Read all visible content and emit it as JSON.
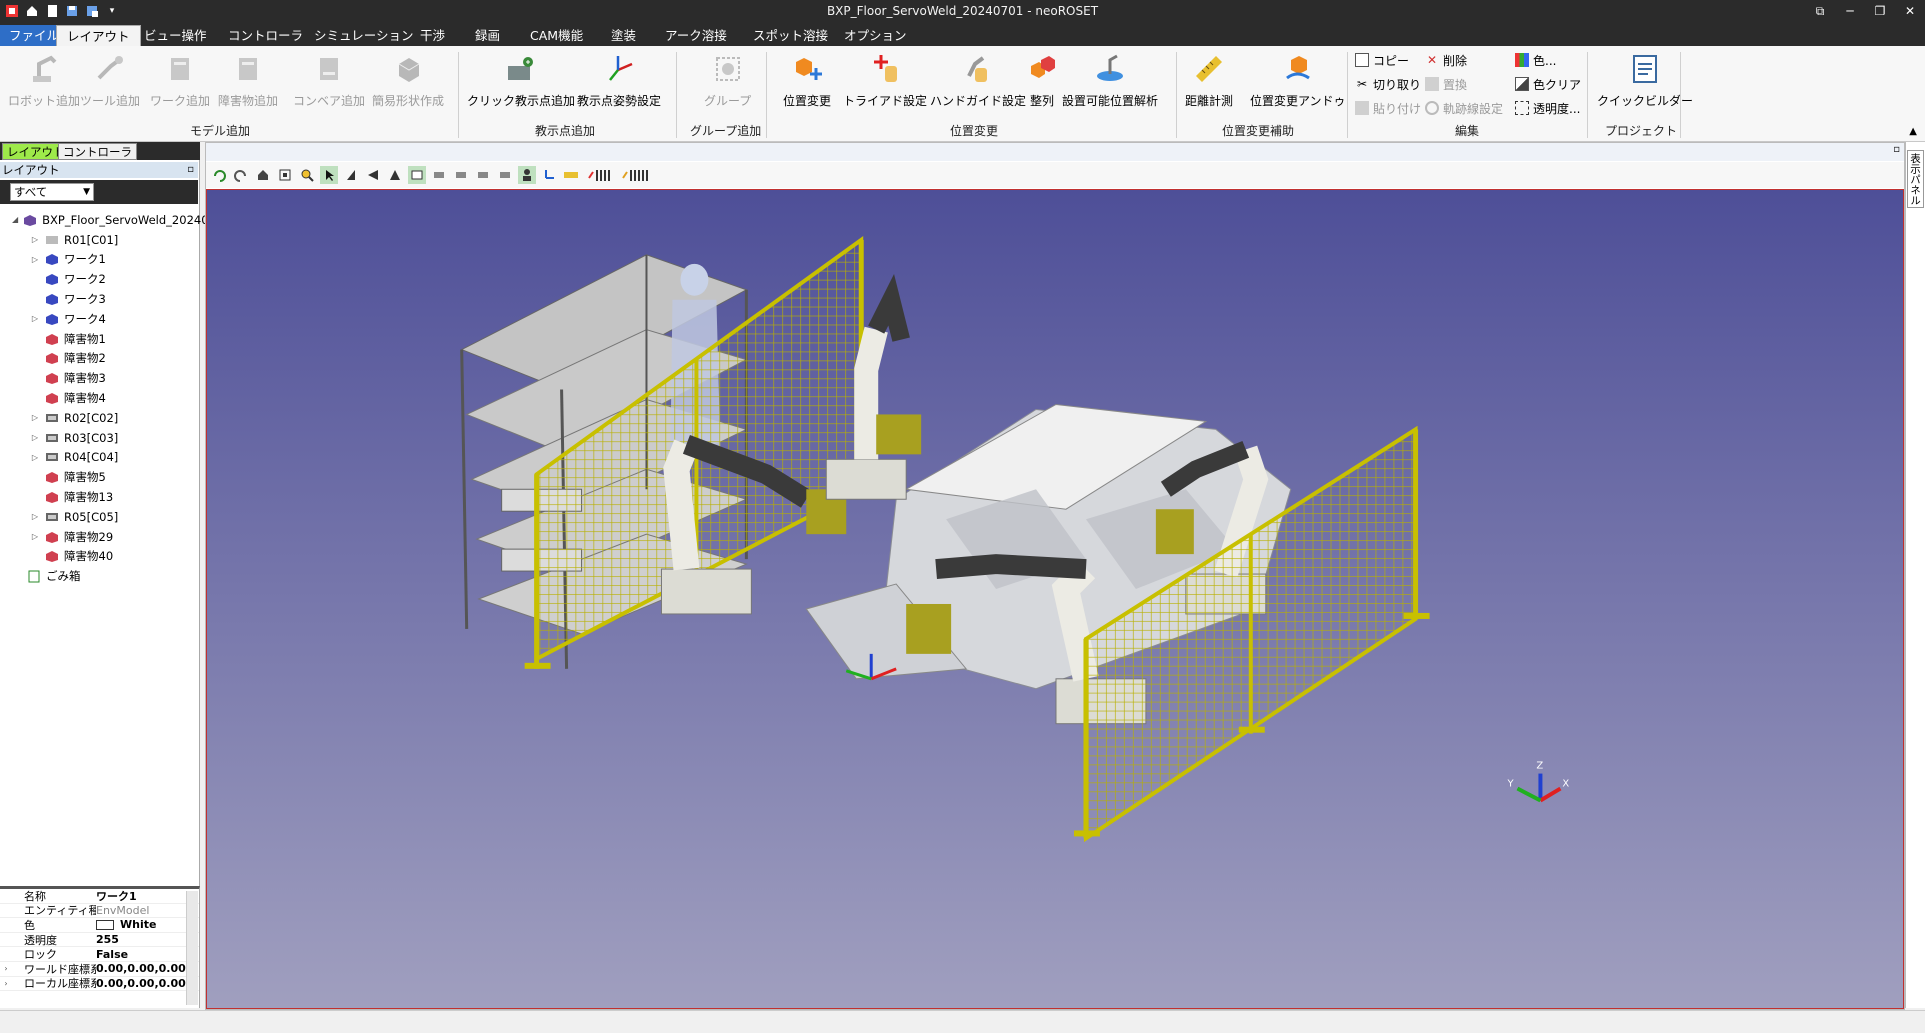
{
  "window": {
    "title": "BXP_Floor_ServoWeld_20240701 - neoROSET"
  },
  "menu": {
    "tabs": [
      "ファイル",
      "レイアウト",
      "ビュー操作",
      "コントローラ",
      "シミュレーション",
      "干渉",
      "録画",
      "CAM機能",
      "塗装",
      "アーク溶接",
      "スポット溶接",
      "オプション"
    ]
  },
  "ribbon": {
    "model_add": {
      "group": "モデル追加",
      "buttons": [
        "ロボット追加",
        "ツール追加",
        "ワーク追加",
        "障害物追加",
        "コンベア追加",
        "簡易形状作成"
      ]
    },
    "teach_add": {
      "group": "教示点追加",
      "buttons": [
        "クリック教示点追加",
        "教示点姿勢設定"
      ]
    },
    "group_add": {
      "group": "グループ追加",
      "buttons": [
        "グループ"
      ]
    },
    "position": {
      "group": "位置変更",
      "buttons": [
        "位置変更",
        "トライアド設定",
        "ハンドガイド設定",
        "整列",
        "設置可能位置解析"
      ]
    },
    "position_aux": {
      "group": "位置変更補助",
      "buttons": [
        "距離計測",
        "位置変更アンドゥ"
      ]
    },
    "edit": {
      "group": "編集",
      "buttons": [
        "コピー",
        "切り取り",
        "貼り付け",
        "削除",
        "置換",
        "軌跡線設定",
        "色...",
        "色クリア",
        "透明度..."
      ]
    },
    "project": {
      "group": "プロジェクト",
      "buttons": [
        "クイックビルダー"
      ]
    }
  },
  "left_panel": {
    "tabs": [
      "レイアウト",
      "コントローラ"
    ],
    "header": "レイアウト",
    "filter": "すべて",
    "tree": [
      {
        "label": "BXP_Floor_ServoWeld_20240",
        "type": "root",
        "indent": 0,
        "exp": "open"
      },
      {
        "label": "R01[C01]",
        "type": "robot-grey",
        "indent": 1,
        "exp": "closed"
      },
      {
        "label": "ワーク1",
        "type": "work",
        "indent": 1,
        "exp": "closed"
      },
      {
        "label": "ワーク2",
        "type": "work",
        "indent": 1,
        "exp": "none"
      },
      {
        "label": "ワーク3",
        "type": "work",
        "indent": 1,
        "exp": "none"
      },
      {
        "label": "ワーク4",
        "type": "work",
        "indent": 1,
        "exp": "closed"
      },
      {
        "label": "障害物1",
        "type": "obstacle",
        "indent": 1,
        "exp": "none"
      },
      {
        "label": "障害物2",
        "type": "obstacle",
        "indent": 1,
        "exp": "none"
      },
      {
        "label": "障害物3",
        "type": "obstacle",
        "indent": 1,
        "exp": "none"
      },
      {
        "label": "障害物4",
        "type": "obstacle",
        "indent": 1,
        "exp": "none"
      },
      {
        "label": "R02[C02]",
        "type": "robot",
        "indent": 1,
        "exp": "closed"
      },
      {
        "label": "R03[C03]",
        "type": "robot",
        "indent": 1,
        "exp": "closed"
      },
      {
        "label": "R04[C04]",
        "type": "robot",
        "indent": 1,
        "exp": "closed"
      },
      {
        "label": "障害物5",
        "type": "obstacle",
        "indent": 1,
        "exp": "none"
      },
      {
        "label": "障害物13",
        "type": "obstacle",
        "indent": 1,
        "exp": "none"
      },
      {
        "label": "R05[C05]",
        "type": "robot",
        "indent": 1,
        "exp": "closed"
      },
      {
        "label": "障害物29",
        "type": "obstacle",
        "indent": 1,
        "exp": "closed"
      },
      {
        "label": "障害物40",
        "type": "obstacle",
        "indent": 1,
        "exp": "none"
      },
      {
        "label": "ごみ箱",
        "type": "trash",
        "indent": 0,
        "exp": "none"
      }
    ]
  },
  "properties": [
    {
      "key": "名称",
      "value": "ワーク1",
      "exp": false,
      "grey": false
    },
    {
      "key": "エンティティ種別",
      "value": "EnvModel",
      "exp": false,
      "grey": true
    },
    {
      "key": "色",
      "value": "White",
      "exp": false,
      "grey": false
    },
    {
      "key": "透明度",
      "value": "255",
      "exp": false,
      "grey": false
    },
    {
      "key": "ロック",
      "value": "False",
      "exp": false,
      "grey": false
    },
    {
      "key": "ワールド座標系",
      "value": "0.00,0.00,0.00,",
      "exp": true,
      "grey": false
    },
    {
      "key": "ローカル座標系",
      "value": "0.00,0.00,0.00,",
      "exp": true,
      "grey": false
    }
  ],
  "right_strip": {
    "label": "表示パネル"
  },
  "axes": {
    "z": "Z",
    "x": "X",
    "y": "Y"
  },
  "colors": {
    "fence": "#d8d020",
    "robot": "#ecebe4",
    "background_top": "#4e4f98",
    "background_bottom": "#9d9cbd"
  }
}
